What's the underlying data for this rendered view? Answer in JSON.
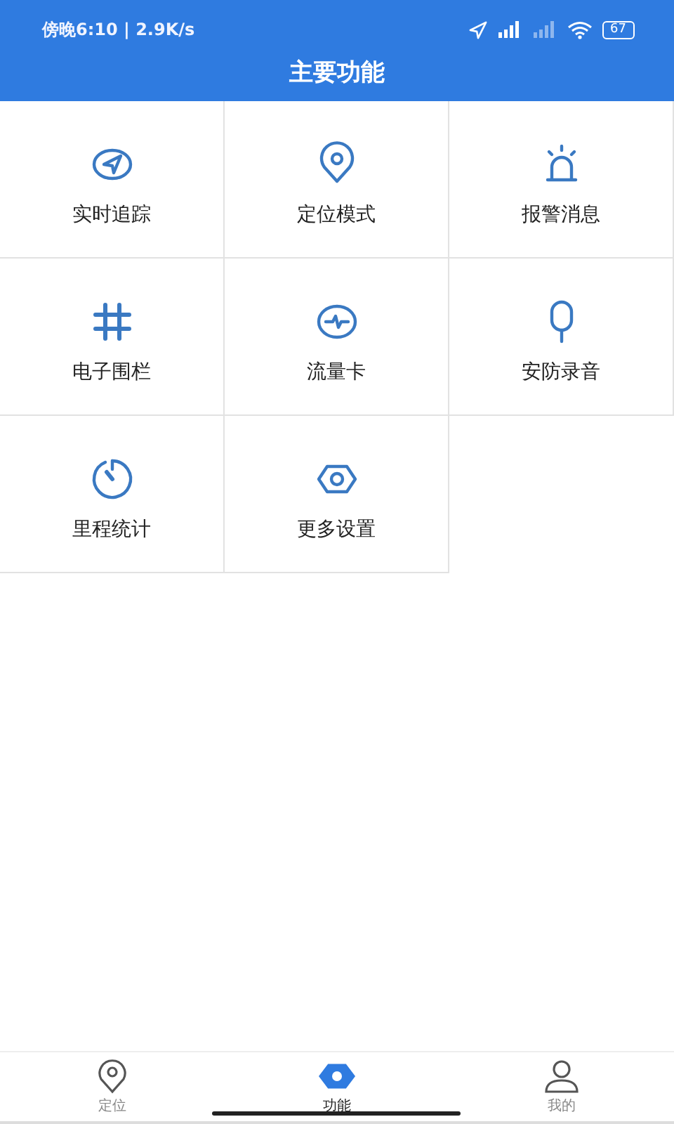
{
  "status_bar": {
    "time": "傍晚6:10 | 2.9K/s",
    "battery": "67"
  },
  "header": {
    "title": "主要功能"
  },
  "features": [
    {
      "label": "实时追踪",
      "kind": "navigate"
    },
    {
      "label": "定位模式",
      "kind": "pin"
    },
    {
      "label": "报警消息",
      "kind": "alarm"
    },
    {
      "label": "电子围栏",
      "kind": "fence"
    },
    {
      "label": "流量卡",
      "kind": "flow"
    },
    {
      "label": "安防录音",
      "kind": "mic"
    },
    {
      "label": "里程统计",
      "kind": "dial"
    },
    {
      "label": "更多设置",
      "kind": "hexagon"
    }
  ],
  "tabs": [
    {
      "label": "定位",
      "kind": "pin",
      "selected": false
    },
    {
      "label": "功能",
      "kind": "hexagon",
      "selected": true
    },
    {
      "label": "我的",
      "kind": "person",
      "selected": false
    }
  ]
}
